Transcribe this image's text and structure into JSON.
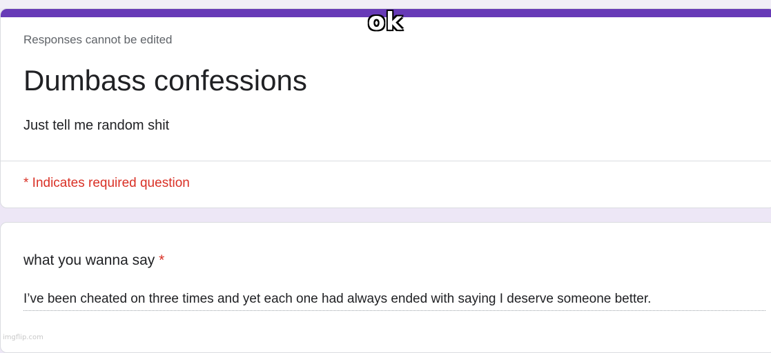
{
  "colors": {
    "accent": "#673ab7",
    "page_background": "#ede7f6",
    "required": "#d93025",
    "muted_text": "#5f6368"
  },
  "form": {
    "responses_note": "Responses cannot be edited",
    "title": "Dumbass confessions",
    "description": "Just tell me random shit",
    "required_note": "* Indicates required question"
  },
  "question": {
    "title": "what you wanna say",
    "required_marker": "*",
    "answer": "I’ve been cheated on three times and yet each one had always ended with saying I deserve someone better."
  },
  "meme": {
    "caption": "ok",
    "watermark": "imgflip.com"
  }
}
